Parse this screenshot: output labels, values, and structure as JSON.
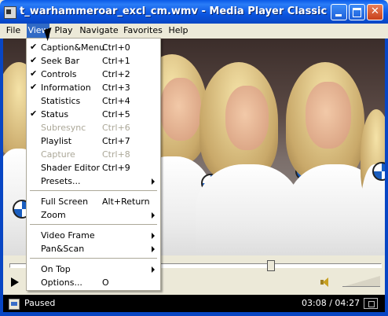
{
  "window": {
    "title": "t_warhammeroar_excl_cm.wmv - Media Player Classic",
    "close_glyph": "✕"
  },
  "menubar": [
    {
      "label": "File"
    },
    {
      "label": "View"
    },
    {
      "label": "Play"
    },
    {
      "label": "Navigate"
    },
    {
      "label": "Favorites"
    },
    {
      "label": "Help"
    }
  ],
  "view_menu": [
    {
      "label": "Caption&Menu",
      "shortcut": "Ctrl+0",
      "checked": "✔"
    },
    {
      "label": "Seek Bar",
      "shortcut": "Ctrl+1",
      "checked": "✔"
    },
    {
      "label": "Controls",
      "shortcut": "Ctrl+2",
      "checked": "✔"
    },
    {
      "label": "Information",
      "shortcut": "Ctrl+3",
      "checked": "✔"
    },
    {
      "label": "Statistics",
      "shortcut": "Ctrl+4",
      "checked": ""
    },
    {
      "label": "Status",
      "shortcut": "Ctrl+5",
      "checked": "✔"
    },
    {
      "label": "Subresync",
      "shortcut": "Ctrl+6",
      "checked": ""
    },
    {
      "label": "Playlist",
      "shortcut": "Ctrl+7",
      "checked": ""
    },
    {
      "label": "Capture",
      "shortcut": "Ctrl+8",
      "checked": ""
    },
    {
      "label": "Shader Editor",
      "shortcut": "Ctrl+9",
      "checked": ""
    },
    {
      "label": "Presets..."
    },
    {
      "label": "Full Screen",
      "shortcut": "Alt+Return"
    },
    {
      "label": "Zoom"
    },
    {
      "label": "Video Frame"
    },
    {
      "label": "Pan&Scan"
    },
    {
      "label": "On Top"
    },
    {
      "label": "Options...",
      "shortcut": "O"
    }
  ],
  "status": {
    "text": "Paused",
    "time": "03:08 / 04:27"
  },
  "seek": {
    "position_fraction": 0.71
  }
}
